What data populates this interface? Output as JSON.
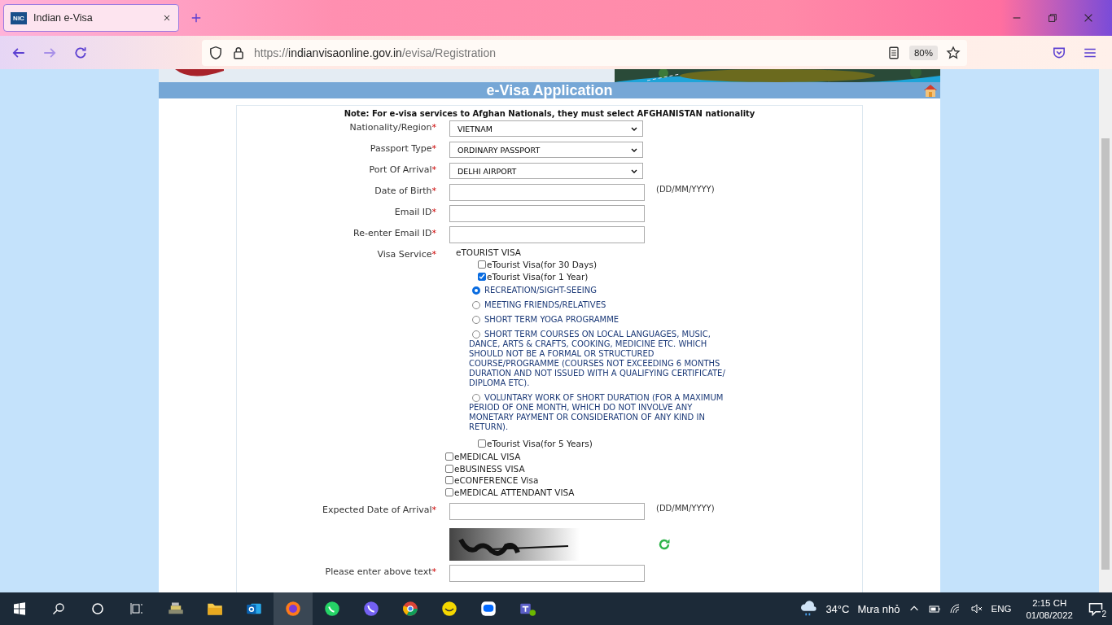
{
  "browser": {
    "tab": {
      "title": "Indian e-Visa",
      "favicon": "NIC"
    },
    "url": {
      "scheme": "https://",
      "host": "indianvisaonline.gov.in",
      "path": "/evisa/Registration"
    },
    "zoom": "80%"
  },
  "page": {
    "title": "e-Visa Application",
    "note": "Note: For e-visa services to Afghan Nationals, they must select AFGHANISTAN nationality",
    "fields": [
      {
        "kind": "select",
        "label": "Nationality/Region",
        "mark": "*",
        "value": "VIETNAM"
      },
      {
        "kind": "select",
        "label": "Passport Type",
        "mark": "*",
        "value": "ORDINARY PASSPORT"
      },
      {
        "kind": "select",
        "label": "Port Of Arrival",
        "mark": "*",
        "value": "DELHI AIRPORT"
      },
      {
        "kind": "text",
        "label": "Date of Birth",
        "mark": "*",
        "hint": "(DD/MM/YYYY)"
      },
      {
        "kind": "text",
        "label": "Email ID",
        "mark": "*"
      },
      {
        "kind": "text",
        "label": "Re-enter Email ID",
        "mark": "*"
      }
    ],
    "visa_service": {
      "label": "Visa Service",
      "group": "eTOURIST VISA",
      "mark": "*",
      "tourist_options": [
        {
          "label": "eTourist Visa(for 30 Days)",
          "checked": false
        },
        {
          "label": "eTourist Visa(for 1 Year)",
          "checked": true,
          "purposes": [
            {
              "label": "RECREATION/SIGHT-SEEING",
              "selected": true
            },
            {
              "label": "MEETING FRIENDS/RELATIVES",
              "selected": false
            },
            {
              "label": "SHORT TERM YOGA PROGRAMME",
              "selected": false
            },
            {
              "label": "SHORT TERM COURSES ON LOCAL LANGUAGES, MUSIC, DANCE, ARTS & CRAFTS, COOKING, MEDICINE ETC. WHICH SHOULD NOT BE A FORMAL OR STRUCTURED COURSE/PROGRAMME (COURSES NOT EXCEEDING 6 MONTHS DURATION AND NOT ISSUED WITH A QUALIFYING CERTIFICATE/ DIPLOMA ETC).",
              "selected": false
            },
            {
              "label": "VOLUNTARY WORK OF SHORT DURATION (FOR A MAXIMUM PERIOD OF ONE MONTH, WHICH DO NOT INVOLVE ANY MONETARY PAYMENT OR CONSIDERATION OF ANY KIND IN RETURN).",
              "selected": false
            }
          ]
        },
        {
          "label": "eTourist Visa(for 5 Years)",
          "checked": false
        }
      ],
      "other_visas": [
        {
          "label": "eMEDICAL VISA",
          "checked": false
        },
        {
          "label": "eBUSINESS VISA",
          "checked": false
        },
        {
          "label": "eCONFERENCE Visa",
          "checked": false
        },
        {
          "label": "eMEDICAL ATTENDANT VISA",
          "checked": false
        }
      ]
    },
    "arrival": {
      "label": "Expected Date of Arrival",
      "mark": "*",
      "hint": "(DD/MM/YYYY)"
    },
    "captcha": {
      "kind": "picture",
      "label": "Please enter above text",
      "mark": "*"
    }
  },
  "taskbar": {
    "weather": {
      "temp": "34°C",
      "text": "Mưa nhỏ"
    },
    "language": "ENG",
    "time": "2:15 CH",
    "date": "01/08/2022",
    "notifications": "2"
  }
}
